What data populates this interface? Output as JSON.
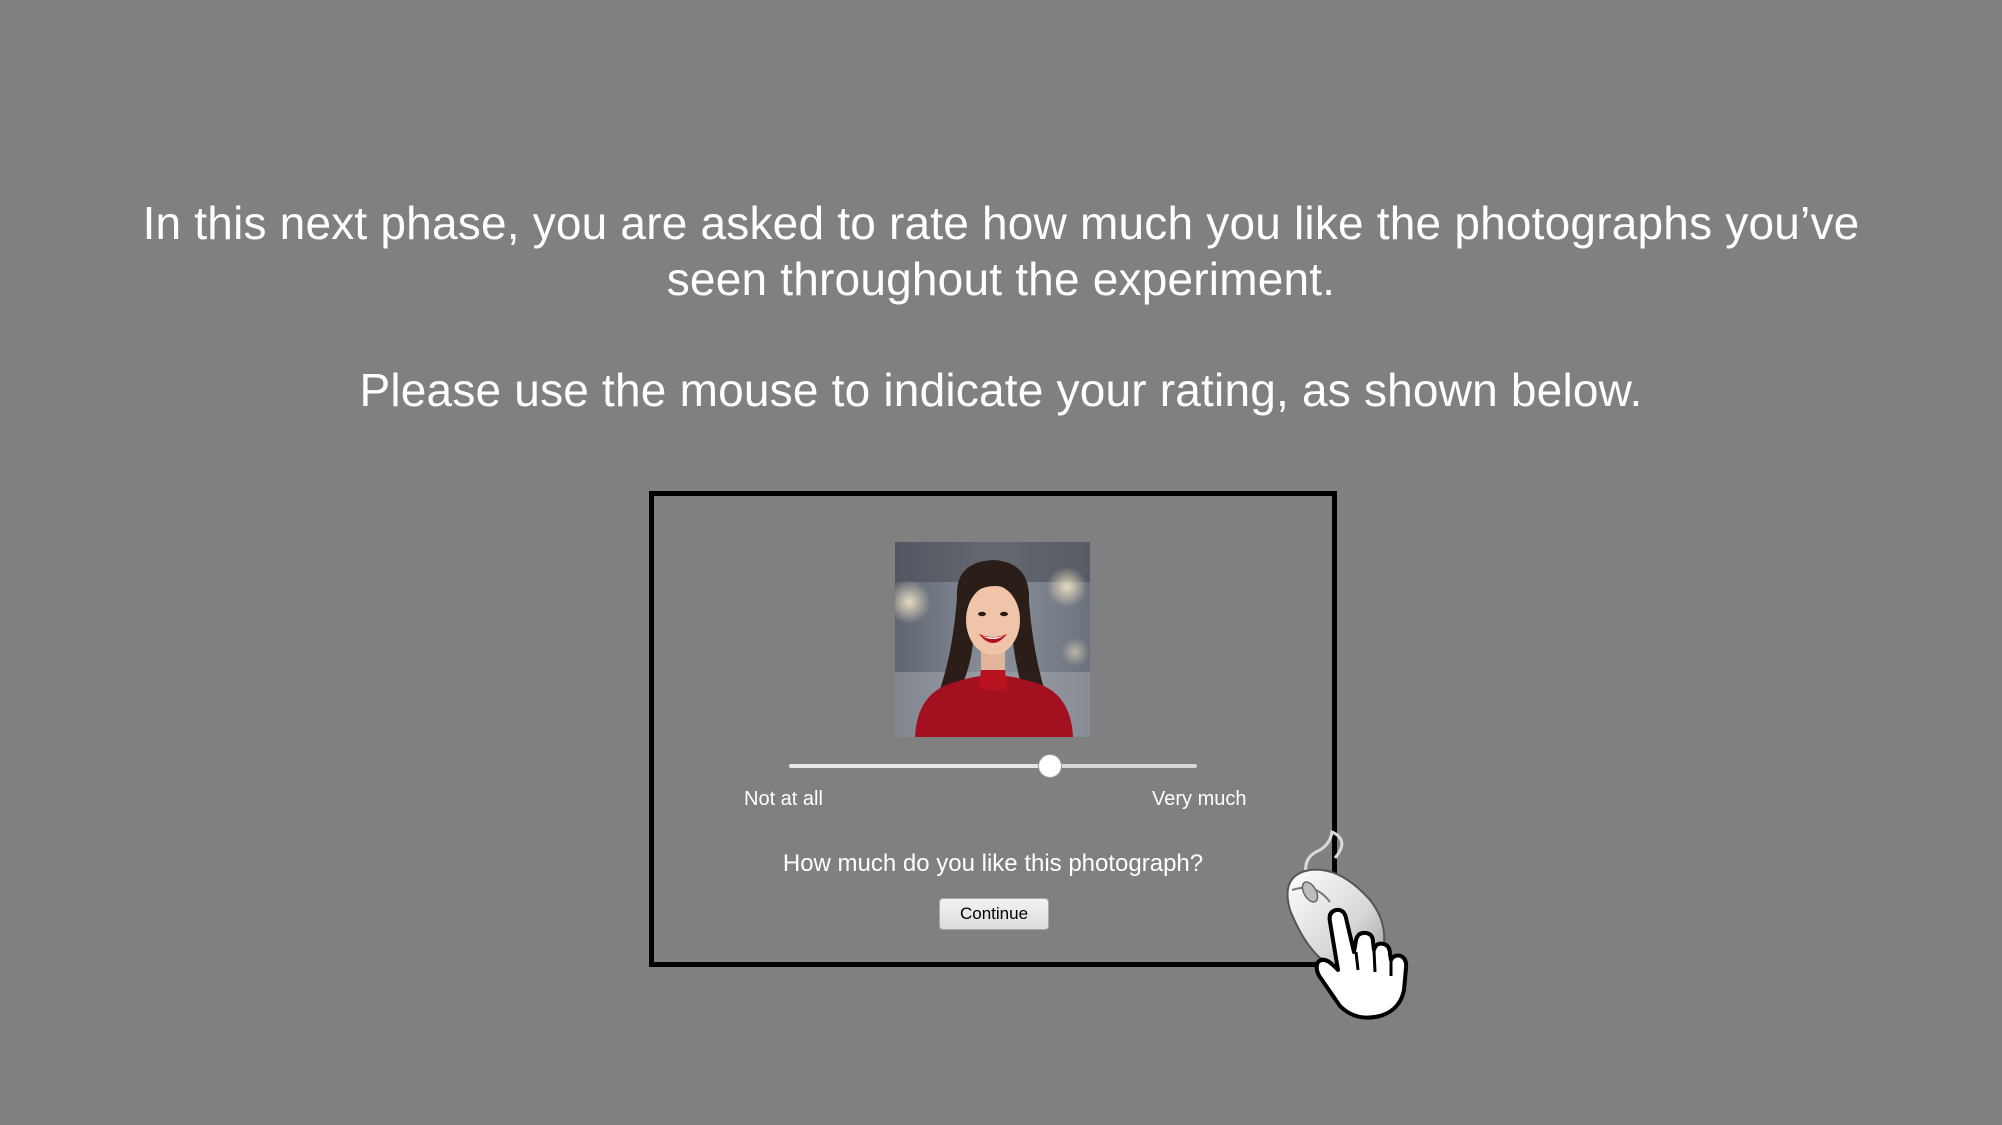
{
  "instructions": {
    "line1": "In this next phase, you are asked to rate how much you like the photographs you’ve",
    "line2": "seen throughout the experiment.",
    "line3": "Please use the mouse to indicate your rating, as shown below."
  },
  "example": {
    "slider": {
      "min_label": "Not at all",
      "max_label": "Very much",
      "value_fraction": 0.64
    },
    "question": "How much do you like this photograph?",
    "continue_label": "Continue"
  },
  "icons": {
    "mouse": "computer-mouse-icon",
    "hand": "pointing-hand-icon"
  }
}
